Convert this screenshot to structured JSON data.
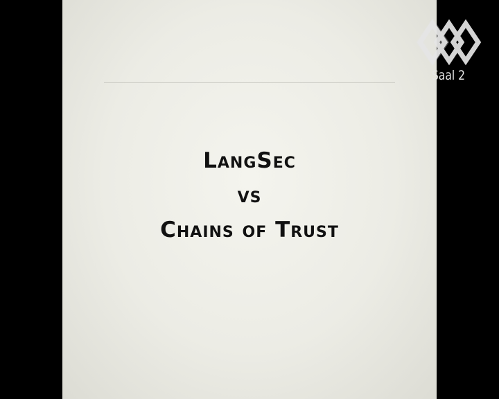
{
  "slide": {
    "title_lines": [
      "LangSec",
      "vs",
      "Chains of Trust"
    ]
  },
  "overlay": {
    "logo_icon": "ccc-diamond-logo-icon",
    "room_label": "Saal 2"
  },
  "colors": {
    "background": "#000000",
    "slide": "#ecece5",
    "text": "#111111",
    "logo": "#e6e6e6"
  }
}
